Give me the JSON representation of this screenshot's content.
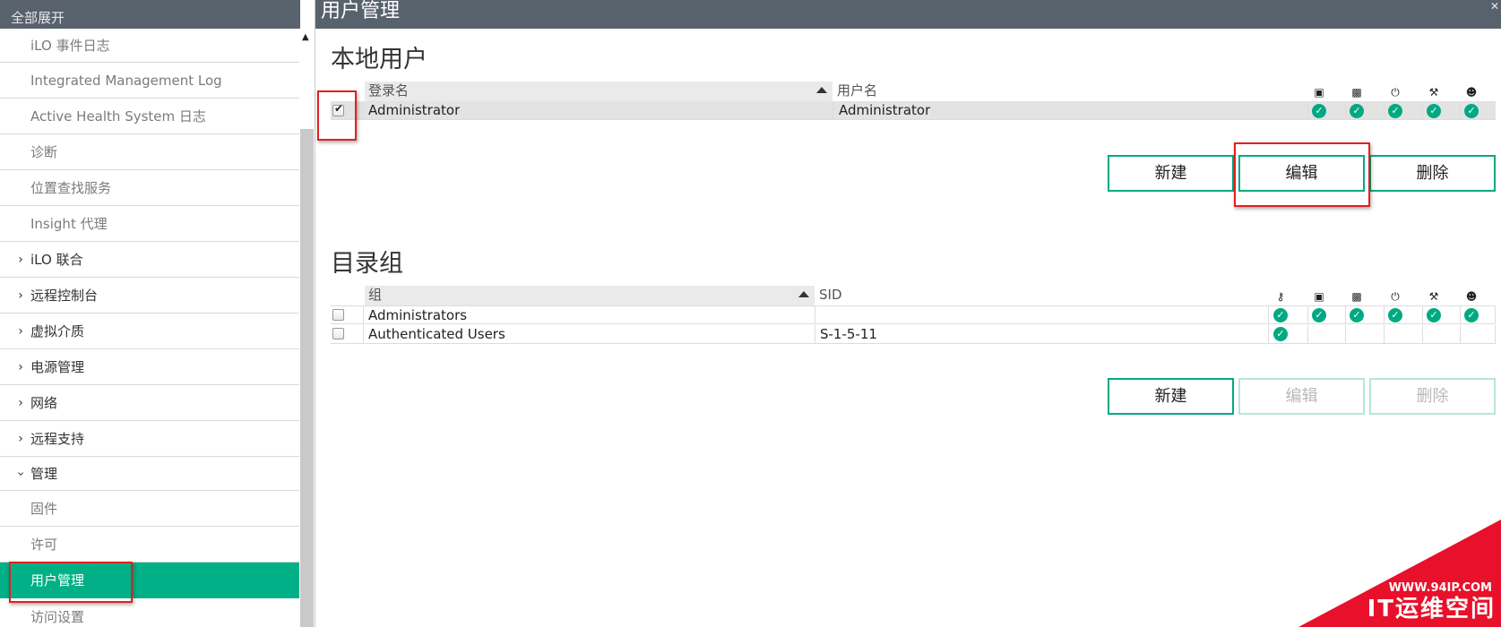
{
  "sidebar": {
    "header": "全部展开",
    "items": [
      {
        "label": "iLO 事件日志",
        "type": "child"
      },
      {
        "label": "Integrated Management Log",
        "type": "child"
      },
      {
        "label": "Active Health System 日志",
        "type": "child"
      },
      {
        "label": "诊断",
        "type": "child"
      },
      {
        "label": "位置查找服务",
        "type": "child"
      },
      {
        "label": "Insight 代理",
        "type": "child"
      },
      {
        "label": "iLO 联合",
        "type": "collapsed"
      },
      {
        "label": "远程控制台",
        "type": "collapsed"
      },
      {
        "label": "虚拟介质",
        "type": "collapsed"
      },
      {
        "label": "电源管理",
        "type": "collapsed"
      },
      {
        "label": "网络",
        "type": "collapsed"
      },
      {
        "label": "远程支持",
        "type": "collapsed"
      },
      {
        "label": "管理",
        "type": "expanded"
      },
      {
        "label": "固件",
        "type": "child"
      },
      {
        "label": "许可",
        "type": "child"
      },
      {
        "label": "用户管理",
        "type": "active"
      },
      {
        "label": "访问设置",
        "type": "child"
      }
    ]
  },
  "header": {
    "title": "用户管理"
  },
  "local_users": {
    "heading": "本地用户",
    "columns": {
      "login": "登录名",
      "username": "用户名"
    },
    "privilege_icons": [
      "remote-console-icon",
      "virtual-media-icon",
      "power-icon",
      "config-wrench-icon",
      "user-admin-icon"
    ],
    "rows": [
      {
        "login": "Administrator",
        "username": "Administrator",
        "selected": true,
        "privileges": [
          true,
          true,
          true,
          true,
          true
        ]
      }
    ],
    "buttons": {
      "new": "新建",
      "edit": "编辑",
      "delete": "删除"
    }
  },
  "directory_groups": {
    "heading": "目录组",
    "columns": {
      "group": "组",
      "sid": "SID"
    },
    "privilege_icons": [
      "login-key-icon",
      "remote-console-icon",
      "virtual-media-icon",
      "power-icon",
      "config-wrench-icon",
      "user-admin-icon"
    ],
    "rows": [
      {
        "group": "Administrators",
        "sid": "",
        "selected": false,
        "privileges": [
          true,
          true,
          true,
          true,
          true,
          true
        ]
      },
      {
        "group": "Authenticated Users",
        "sid": "S-1-5-11",
        "selected": false,
        "privileges": [
          true,
          false,
          false,
          false,
          false,
          false
        ]
      }
    ],
    "buttons": {
      "new": "新建",
      "edit": "编辑",
      "delete": "删除"
    },
    "buttons_disabled": [
      "edit",
      "delete"
    ]
  },
  "watermark": {
    "url": "WWW.94IP.COM",
    "name": "IT运维空间",
    "color": "#e8102a"
  },
  "colors": {
    "accent": "#01a982",
    "active_nav": "#01b087",
    "titlebar": "#58626d",
    "highlight": "#e02020"
  }
}
